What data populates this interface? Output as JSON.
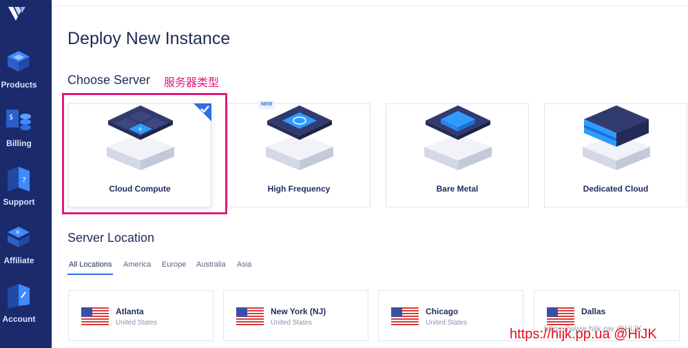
{
  "sidebar": {
    "items": [
      {
        "label": "Products",
        "icon": "products-icon"
      },
      {
        "label": "Billing",
        "icon": "billing-icon"
      },
      {
        "label": "Support",
        "icon": "support-icon"
      },
      {
        "label": "Affiliate",
        "icon": "affiliate-icon"
      },
      {
        "label": "Account",
        "icon": "account-icon"
      }
    ]
  },
  "main": {
    "title": "Deploy New Instance",
    "choose_server": {
      "heading": "Choose Server",
      "annotation": "服务器类型",
      "options": [
        {
          "label": "Cloud Compute",
          "selected": true,
          "icon": "cloud-compute-icon"
        },
        {
          "label": "High Frequency",
          "badge": "NEW",
          "icon": "high-frequency-icon"
        },
        {
          "label": "Bare Metal",
          "icon": "bare-metal-icon"
        },
        {
          "label": "Dedicated Cloud",
          "icon": "dedicated-cloud-icon"
        }
      ]
    },
    "server_location": {
      "heading": "Server Location",
      "tabs": [
        "All Locations",
        "America",
        "Europe",
        "Australia",
        "Asia"
      ],
      "active_tab": "All Locations",
      "locations": [
        {
          "city": "Atlanta",
          "country": "United States"
        },
        {
          "city": "New York (NJ)",
          "country": "United States"
        },
        {
          "city": "Chicago",
          "country": "United States"
        },
        {
          "city": "Dallas",
          "country": ""
        }
      ]
    }
  },
  "watermarks": {
    "gray": "https://www.hijk.pw @HiJK",
    "red": "https://hijk.pp.ua @HiJK"
  },
  "colors": {
    "sidebar": "#1b2a6b",
    "accent": "#2f6ee7",
    "highlight": "#e0197d",
    "watermark": "#e0101c"
  }
}
